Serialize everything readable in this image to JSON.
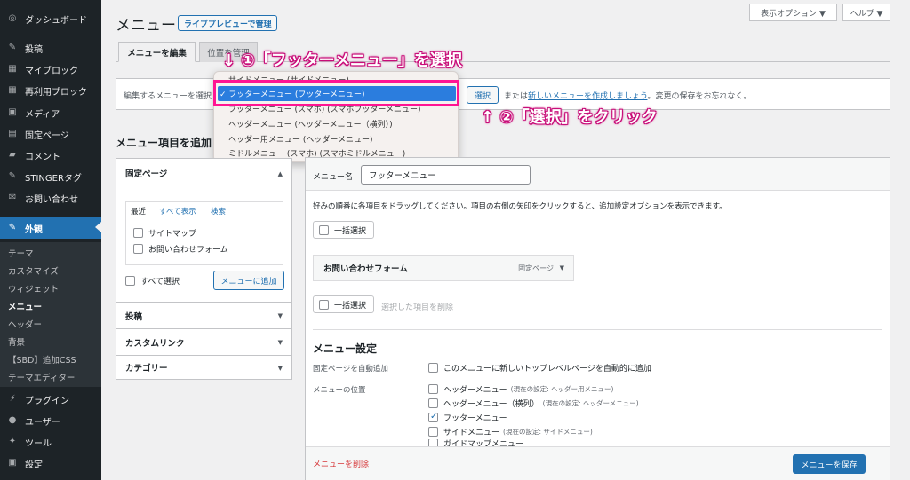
{
  "sidebar": {
    "items": [
      {
        "label": "ダッシュボード",
        "icon": "dashboard-icon",
        "glyph": "◎"
      },
      {
        "label": "投稿",
        "icon": "pin-icon",
        "glyph": "✎"
      },
      {
        "label": "マイブロック",
        "icon": "blocks-icon",
        "glyph": "▦"
      },
      {
        "label": "再利用ブロック",
        "icon": "blocks-icon",
        "glyph": "▦"
      },
      {
        "label": "メディア",
        "icon": "media-icon",
        "glyph": "▣"
      },
      {
        "label": "固定ページ",
        "icon": "page-icon",
        "glyph": "▤"
      },
      {
        "label": "コメント",
        "icon": "comment-icon",
        "glyph": "▰"
      },
      {
        "label": "STINGERタグ",
        "icon": "pin-icon",
        "glyph": "✎"
      },
      {
        "label": "お問い合わせ",
        "icon": "mail-icon",
        "glyph": "✉"
      },
      {
        "label": "外観",
        "icon": "appearance-icon",
        "glyph": "✎"
      }
    ],
    "submenu": [
      "テーマ",
      "カスタマイズ",
      "ウィジェット",
      "メニュー",
      "ヘッダー",
      "背景",
      "【SBD】追加CSS",
      "テーマエディター"
    ],
    "bottom": [
      {
        "label": "プラグイン",
        "icon": "plugin-icon",
        "glyph": "⚡"
      },
      {
        "label": "ユーザー",
        "icon": "user-icon",
        "glyph": "●"
      },
      {
        "label": "ツール",
        "icon": "tool-icon",
        "glyph": "✦"
      },
      {
        "label": "設定",
        "icon": "settings-icon",
        "glyph": "▣"
      }
    ]
  },
  "top": {
    "screen_options": "表示オプション ▼",
    "help": "ヘルプ ▼"
  },
  "header": {
    "title": "メニュー",
    "live_preview": "ライブプレビューで管理"
  },
  "tabs": {
    "edit": "メニューを編集",
    "manage": "位置を管理"
  },
  "editbar": {
    "label": "編集するメニューを選択",
    "select_button": "選択",
    "or": "または",
    "create_link": "新しいメニューを作成しましょう",
    "tail": "。変更の保存をお忘れなく。"
  },
  "dropdown": {
    "options": [
      "サイドメニュー (サイドメニュー)",
      "✓ フッターメニュー (フッターメニュー)",
      "フッターメニュー (スマホ) (スマホフッターメニュー)",
      "ヘッダーメニュー (ヘッダーメニュー（横列）)",
      "ヘッダー用メニュー (ヘッダーメニュー)",
      "ミドルメニュー (スマホ) (スマホミドルメニュー)"
    ],
    "selected_index": 1
  },
  "annotations": {
    "step1": "↓ ①「フッターメニュー」を選択",
    "step2": "↑ ②「選択」をクリック"
  },
  "add_items": {
    "heading": "メニュー項目を追加",
    "pages": "固定ページ",
    "tabs": [
      "最近",
      "すべて表示",
      "検索"
    ],
    "pages_list": [
      "サイトマップ",
      "お問い合わせフォーム"
    ],
    "select_all": "すべて選択",
    "add_button": "メニューに追加",
    "sections": [
      "投稿",
      "カスタムリンク",
      "カテゴリー"
    ]
  },
  "menu_structure": {
    "name_label": "メニュー名",
    "name_value": "フッターメニュー",
    "instructions": "好みの順番に各項目をドラッグしてください。項目の右側の矢印をクリックすると、追加設定オプションを表示できます。",
    "bulk_select": "一括選択",
    "item": {
      "title": "お問い合わせフォーム",
      "type": "固定ページ"
    },
    "delete_selected": "選択した項目を削除"
  },
  "menu_settings": {
    "heading": "メニュー設定",
    "auto_add_label": "固定ページを自動追加",
    "auto_add_text": "このメニューに新しいトップレベルページを自動的に追加",
    "location_label": "メニューの位置",
    "locations": [
      {
        "name": "ヘッダーメニュー",
        "note": "(現在の設定: ヘッダー用メニュー)",
        "checked": false
      },
      {
        "name": "ヘッダーメニュー（横列）",
        "note": "(現在の設定: ヘッダーメニュー)",
        "checked": false
      },
      {
        "name": "フッターメニュー",
        "note": "",
        "checked": true
      },
      {
        "name": "サイドメニュー",
        "note": "(現在の設定: サイドメニュー)",
        "checked": false
      },
      {
        "name": "ガイドマップメニュー",
        "note": "",
        "checked": false
      }
    ]
  },
  "footer": {
    "delete_menu": "メニューを削除",
    "save_menu": "メニューを保存"
  },
  "colors": {
    "accent": "#2271b1",
    "sidebar_bg": "#1d2327",
    "highlight": "#ff1493"
  }
}
